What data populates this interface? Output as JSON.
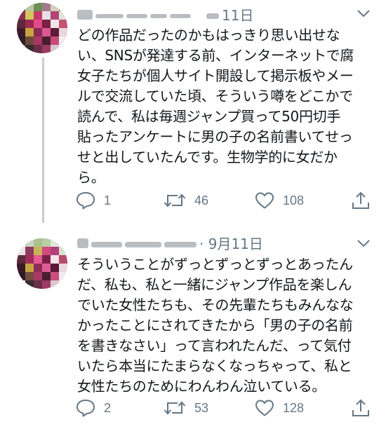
{
  "tweets": [
    {
      "date": "11日",
      "lines": [
        "どの作品だったのかもはっきり思い出せな",
        "い、SNSが発達する前、インターネットで腐",
        "女子たちが個人サイト開設して掲示板やメー",
        "ルで交流していた頃、そういう噂をどこかで",
        "読んで、私は毎週ジャンプ買って50円切手",
        "貼ったアンケートに男の子の名前書いてせっ",
        "せと出していたんです。生物学的に女だか",
        "ら。"
      ],
      "actions": {
        "reply": "1",
        "retweet": "46",
        "like": "108"
      }
    },
    {
      "date": "· 9月11日",
      "lines": [
        "そういうことがずっとずっとずっとあったん",
        "だ、私も、私と一緒にジャンプ作品を楽しん",
        "でいた女性たちも、その先輩たちもみんなな",
        "かったことにされてきたから「男の子の名前",
        "を書きなさい」って言われたんだ、って気付",
        "いたら本当にたまらなくなっちゃって、私と",
        "女性たちのためにわんわん泣いている。"
      ],
      "actions": {
        "reply": "2",
        "retweet": "53",
        "like": "128"
      }
    }
  ],
  "icons": {
    "more": "chevron-down-icon",
    "reply": "reply-icon",
    "retweet": "retweet-icon",
    "like": "heart-icon",
    "share": "share-icon"
  },
  "colors": {
    "text": "#14171a",
    "muted": "#657786",
    "thread_line": "#c4cfd6"
  }
}
